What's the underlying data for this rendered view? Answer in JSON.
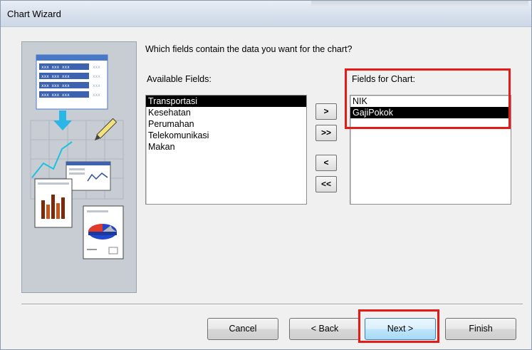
{
  "window": {
    "title": "Chart Wizard"
  },
  "prompt": "Which fields contain the data you want for the chart?",
  "available_fields": {
    "label": "Available Fields:",
    "items": [
      "Transportasi",
      "Kesehatan",
      "Perumahan",
      "Telekomunikasi",
      "Makan"
    ],
    "selected": "Transportasi"
  },
  "chart_fields": {
    "label": "Fields for Chart:",
    "items": [
      "NIK",
      "GajiPokok"
    ],
    "selected": "GajiPokok"
  },
  "move_buttons": {
    "add_one": ">",
    "add_all": ">>",
    "remove_one": "<",
    "remove_all": "<<"
  },
  "buttons": {
    "cancel": "Cancel",
    "back": "< Back",
    "next": "Next >",
    "finish": "Finish"
  },
  "highlight_color": "#e41b17",
  "selection_color": "#000000"
}
